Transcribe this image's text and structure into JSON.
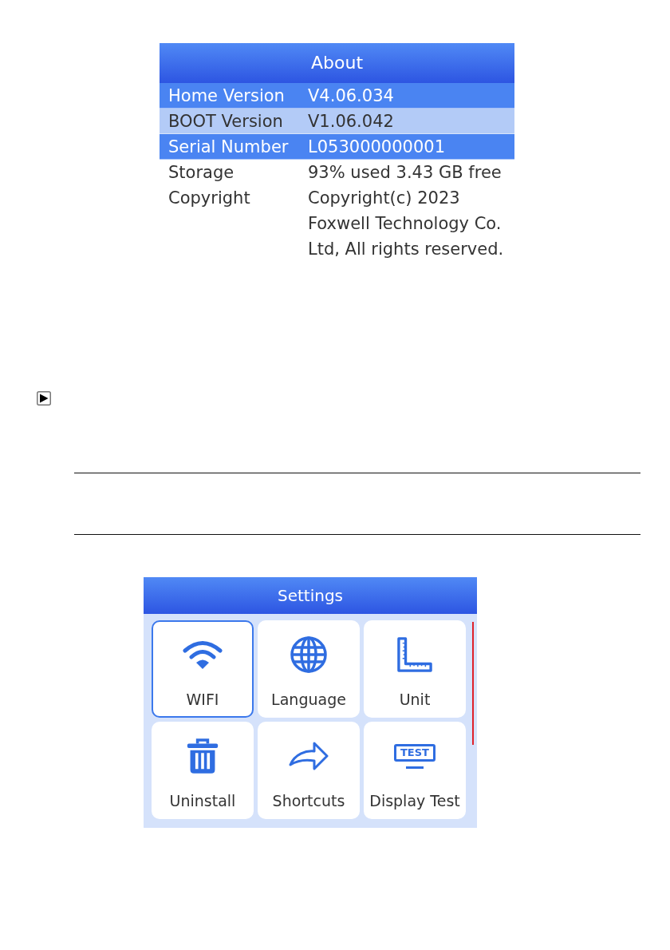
{
  "about": {
    "title": "About",
    "rows": [
      {
        "label": "Home Version",
        "value": "V4.06.034",
        "color": "#4a84f2"
      },
      {
        "label": "BOOT Version",
        "value": "V1.06.042",
        "color": "#b3cbf7"
      },
      {
        "label": "Serial Number",
        "value": "L053000000001",
        "color": "#4a84f2"
      },
      {
        "label": "Storage",
        "value": "93% used 3.43 GB free"
      },
      {
        "label": "Copyright",
        "value": "Copyright(c) 2023\nFoxwell Technology Co.\nLtd, All rights reserved."
      }
    ]
  },
  "settings": {
    "title": "Settings",
    "tiles": [
      {
        "label": "WIFI",
        "selected": true
      },
      {
        "label": "Language",
        "selected": false
      },
      {
        "label": "Unit",
        "selected": false
      },
      {
        "label": "Uninstall",
        "selected": false
      },
      {
        "label": "Shortcuts",
        "selected": false
      },
      {
        "label": "Display Test",
        "selected": false,
        "icon_text": "TEST"
      }
    ]
  }
}
